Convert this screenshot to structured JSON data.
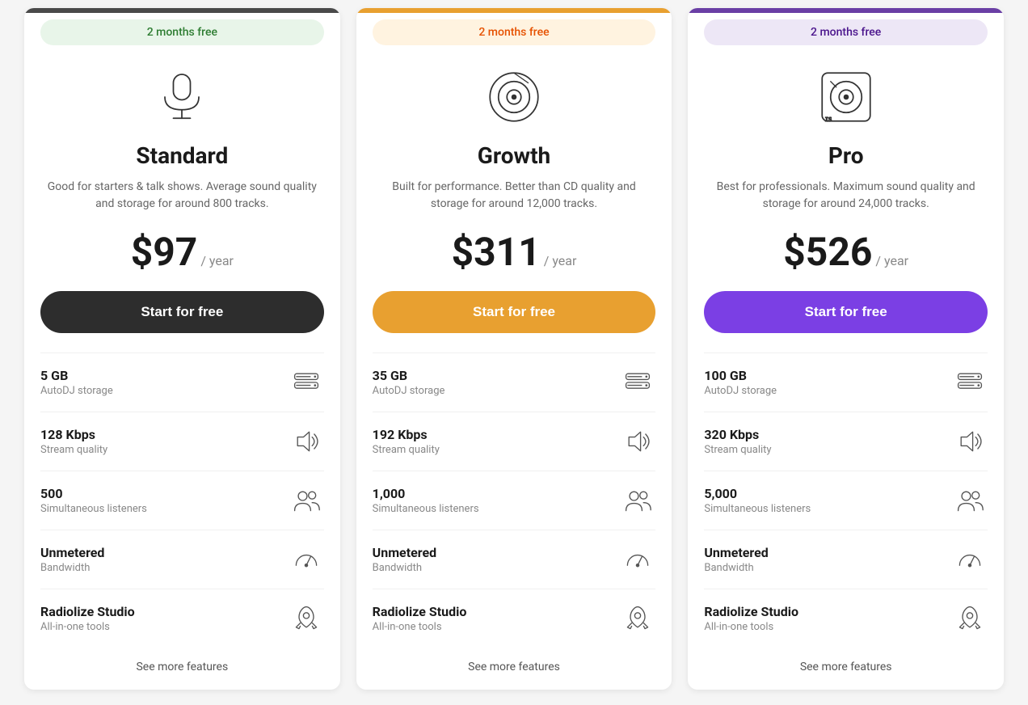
{
  "plans": [
    {
      "id": "standard",
      "badge": "2 months free",
      "name": "Standard",
      "description": "Good for starters & talk shows. Average sound quality and storage for around 800 tracks.",
      "price": "$97",
      "period": "/ year",
      "cta": "Start for free",
      "features": [
        {
          "value": "5 GB",
          "label": "AutoDJ storage",
          "icon": "storage"
        },
        {
          "value": "128 Kbps",
          "label": "Stream quality",
          "icon": "speaker"
        },
        {
          "value": "500",
          "label": "Simultaneous listeners",
          "icon": "users"
        },
        {
          "value": "Unmetered",
          "label": "Bandwidth",
          "icon": "gauge"
        },
        {
          "value": "Radiolize Studio",
          "label": "All-in-one tools",
          "icon": "rocket"
        }
      ],
      "see_more": "See more features"
    },
    {
      "id": "growth",
      "badge": "2 months free",
      "name": "Growth",
      "description": "Built for performance. Better than CD quality and storage for around 12,000 tracks.",
      "price": "$311",
      "period": "/ year",
      "cta": "Start for free",
      "features": [
        {
          "value": "35 GB",
          "label": "AutoDJ storage",
          "icon": "storage"
        },
        {
          "value": "192 Kbps",
          "label": "Stream quality",
          "icon": "speaker"
        },
        {
          "value": "1,000",
          "label": "Simultaneous listeners",
          "icon": "users"
        },
        {
          "value": "Unmetered",
          "label": "Bandwidth",
          "icon": "gauge"
        },
        {
          "value": "Radiolize Studio",
          "label": "All-in-one tools",
          "icon": "rocket"
        }
      ],
      "see_more": "See more features"
    },
    {
      "id": "pro",
      "badge": "2 months free",
      "name": "Pro",
      "description": "Best for professionals. Maximum sound quality and storage for around 24,000 tracks.",
      "price": "$526",
      "period": "/ year",
      "cta": "Start for free",
      "features": [
        {
          "value": "100 GB",
          "label": "AutoDJ storage",
          "icon": "storage"
        },
        {
          "value": "320 Kbps",
          "label": "Stream quality",
          "icon": "speaker"
        },
        {
          "value": "5,000",
          "label": "Simultaneous listeners",
          "icon": "users"
        },
        {
          "value": "Unmetered",
          "label": "Bandwidth",
          "icon": "gauge"
        },
        {
          "value": "Radiolize Studio",
          "label": "All-in-one tools",
          "icon": "rocket"
        }
      ],
      "see_more": "See more features"
    }
  ]
}
